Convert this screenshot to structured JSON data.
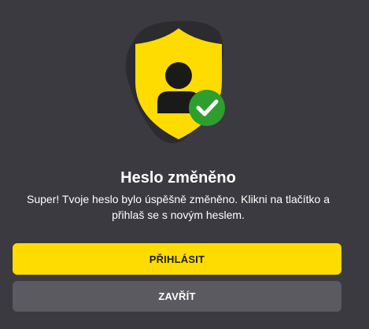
{
  "dialog": {
    "title": "Heslo změněno",
    "message": "Super! Tvoje heslo bylo úspěšně změněno. Klikni na tlačítko a přihlaš se s novým heslem.",
    "primary_button_label": "PŘIHLÁSIT",
    "secondary_button_label": "ZAVŘÍT"
  },
  "illustration": {
    "icon": "shield-user-check-icon",
    "shield_color": "#ffdc00",
    "badge_color": "#2e9e2e",
    "backdrop_color": "#2b2b30"
  },
  "colors": {
    "background": "#3a3a40",
    "accent": "#ffdc00",
    "secondary_button": "#5a5a60",
    "success": "#2e9e2e"
  }
}
